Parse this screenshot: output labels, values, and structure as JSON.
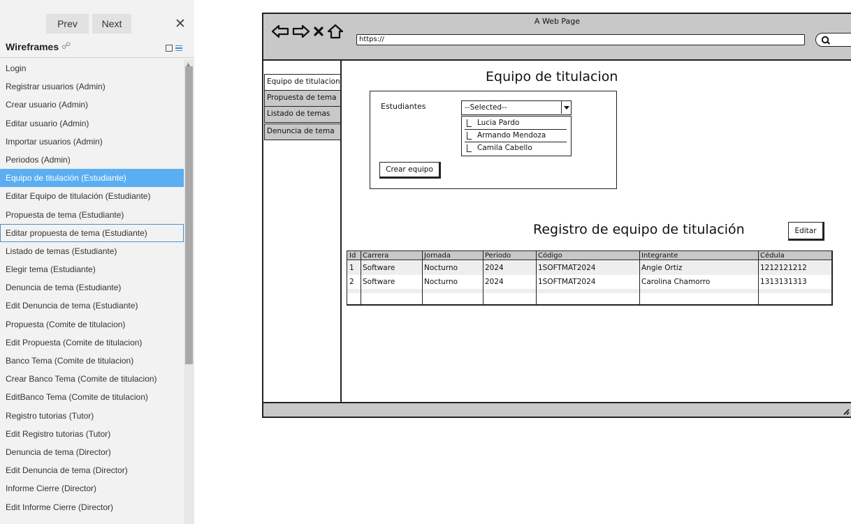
{
  "left_panel": {
    "prev_label": "Prev",
    "next_label": "Next",
    "close_glyph": "✕",
    "title": "Wireframes",
    "link_glyph": "☍",
    "items": [
      "Login",
      "Registrar usuarios (Admin)",
      "Crear usuario (Admin)",
      "Editar usuario (Admin)",
      "Importar usuarios (Admin)",
      "Periodos (Admin)",
      "Equipo de titulación (Estudiante)",
      "Editar Equipo de titulación (Estudiante)",
      "Propuesta de tema (Estudiante)",
      "Editar propuesta de tema (Estudiante)",
      "Listado de temas (Estudiante)",
      "Elegir tema (Estudiante)",
      "Denuncia de tema (Estudiante)",
      "Edit Denuncia de tema (Estudiante)",
      "Propuesta (Comite de titulacion)",
      "Edit Propuesta (Comite de titulacion)",
      "Banco Tema (Comite de titulacion)",
      "Crear Banco Tema (Comite de titulacion)",
      "EditBanco Tema (Comite de titulacion)",
      "Registro tutorias (Tutor)",
      "Edit Registro tutorias (Tutor)",
      "Denuncia de tema (Director)",
      "Edit Denuncia de tema (Director)",
      "Informe Cierre (Director)",
      "Edit Informe Cierre (Director)"
    ],
    "selected_index": 6,
    "focused_index": 9,
    "selected_color": "#5aaef1"
  },
  "browser": {
    "page_title": "A Web Page",
    "url": "https://",
    "icons": [
      "back-arrow-icon",
      "forward-arrow-icon",
      "stop-icon",
      "home-icon",
      "search-icon"
    ],
    "tabs": [
      {
        "label": "Equipo de titulacion",
        "active": true
      },
      {
        "label": "Propuesta de tema",
        "active": false
      },
      {
        "label": "Listado de temas",
        "active": false
      },
      {
        "label": "Denuncia de tema",
        "active": false
      }
    ],
    "main_heading": "Equipo de titulacion",
    "form": {
      "students_label": "Estudiantes",
      "select_value": "--Selected--",
      "options": [
        "Lucia Pardo",
        "Armando Mendoza",
        "Camila Cabello"
      ],
      "create_button": "Crear equipo"
    },
    "registry": {
      "heading": "Registro de equipo de titulación",
      "edit_button": "Editar",
      "columns": [
        "Id",
        "Carrera",
        "Jornada",
        "Periodo",
        "Código",
        "Integrante",
        "Cédula"
      ],
      "rows": [
        [
          "1",
          "Software",
          "Nocturno",
          "2024",
          "1SOFTMAT2024",
          "Angie Ortiz",
          "1212121212"
        ],
        [
          "2",
          "Software",
          "Nocturno",
          "2024",
          "1SOFTMAT2024",
          "Carolina Chamorro",
          "1313131313"
        ]
      ]
    }
  }
}
